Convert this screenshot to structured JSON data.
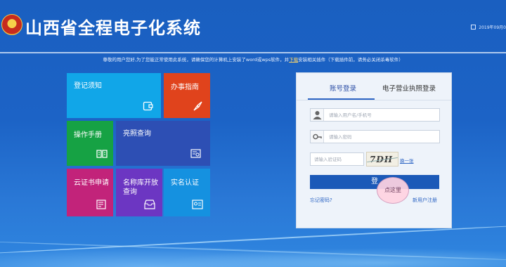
{
  "header": {
    "title": "山西省全程电子化系统",
    "date": "2019年09月0"
  },
  "notice": {
    "text_before": "尊敬的用户您好,为了您能正常使用此系统，请确保您的计算机上安装了word或wps软件，并",
    "link": "下载",
    "text_after": "安装相关插件（下载插件前，请务必关闭杀毒软件）"
  },
  "tiles": {
    "register_notice": "登记须知",
    "guide": "办事指南",
    "manual": "操作手册",
    "license_query": "亮照查询",
    "cert_apply": "云证书申请",
    "name_db": "名称库开放查询",
    "realname": "实名认证"
  },
  "login": {
    "tab_account": "账号登录",
    "tab_license": "电子营业执照登录",
    "user_placeholder": "请输入用户名/手机号",
    "pass_placeholder": "请输入密码",
    "captcha_placeholder": "请输入验证码",
    "captcha_text": "7DH",
    "refresh": "换一张",
    "button": "登",
    "bubble": "点这里",
    "forgot": "忘记密码?",
    "register": "新用户注册"
  },
  "colors": {
    "background": "#1c63c6",
    "tile_blue": "#11a6e8",
    "tile_red": "#e0431c",
    "tile_green": "#16a244",
    "tile_navy": "#2d4fb4",
    "tile_magenta": "#c2237a",
    "tile_purple": "#6c36c2",
    "tile_sky": "#1591e0",
    "login_button": "#1b59b8"
  },
  "icons": {
    "emblem": "national-emblem",
    "calendar": "calendar-icon",
    "user": "user-icon",
    "key": "key-icon"
  }
}
